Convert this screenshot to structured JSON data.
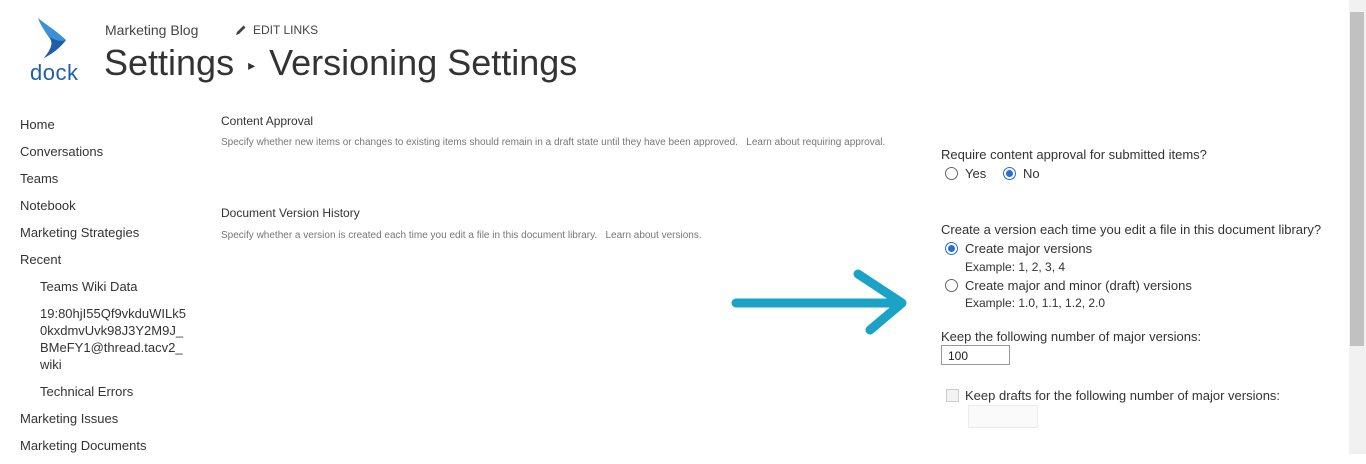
{
  "header": {
    "logo_text": "dock",
    "site_name": "Marketing Blog",
    "edit_links": "EDIT LINKS",
    "title_parent": "Settings",
    "title_separator": "▸",
    "title_current": "Versioning Settings"
  },
  "leftnav": {
    "items": [
      {
        "label": "Home"
      },
      {
        "label": "Conversations"
      },
      {
        "label": "Teams"
      },
      {
        "label": "Notebook"
      },
      {
        "label": "Marketing Strategies"
      },
      {
        "label": "Recent"
      },
      {
        "label": "Teams Wiki Data"
      },
      {
        "label": "19:80hjI55Qf9vkduWILk50kxdmvUvk98J3Y2M9J_BMeFY1@thread.tacv2_wiki"
      },
      {
        "label": "Technical Errors"
      },
      {
        "label": "Marketing Issues"
      },
      {
        "label": "Marketing Documents"
      }
    ]
  },
  "content_approval": {
    "title": "Content Approval",
    "description": "Specify whether new items or changes to existing items should remain in a draft state until they have been approved.",
    "learn_link": "Learn about requiring approval.",
    "question": "Require content approval for submitted items?",
    "option_yes": "Yes",
    "option_no": "No",
    "selected": "No"
  },
  "version_history": {
    "title": "Document Version History",
    "description": "Specify whether a version is created each time you edit a file in this document library.",
    "learn_link": "Learn about versions.",
    "question": "Create a version each time you edit a file in this document library?",
    "option_major": "Create major versions",
    "example_major": "Example: 1, 2, 3, 4",
    "option_minor": "Create major and minor (draft) versions",
    "example_minor": "Example: 1.0, 1.1, 1.2, 2.0",
    "selected": "Create major versions",
    "keep_major_label": "Keep the following number of major versions:",
    "keep_major_value": "100",
    "keep_drafts_label": "Keep drafts for the following number of major versions:",
    "keep_drafts_value": ""
  },
  "colors": {
    "accent": "#2b6cd1",
    "arrow": "#1aa3c6",
    "logo": "#1e5fa8"
  }
}
